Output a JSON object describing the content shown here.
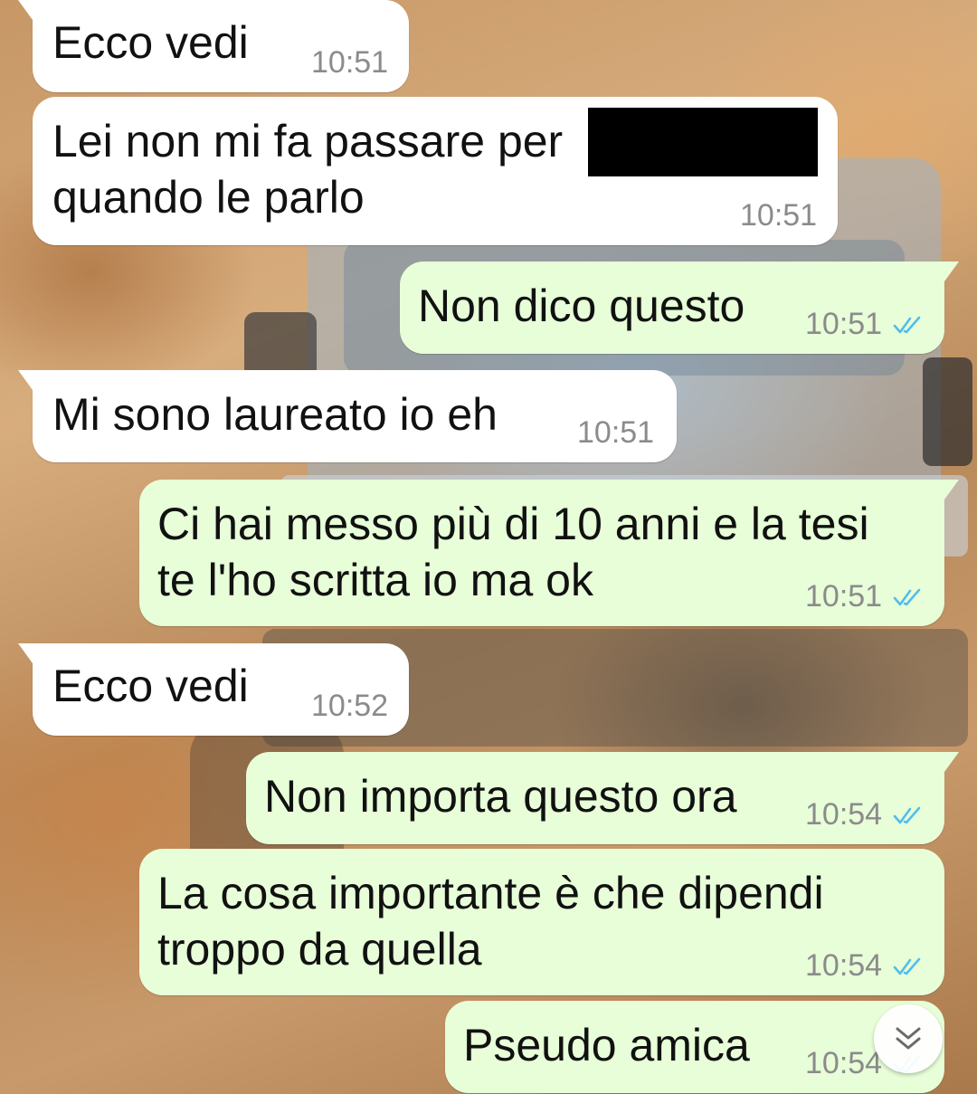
{
  "chat": {
    "messages": [
      {
        "text_lines": [
          "Ecco vedi"
        ],
        "time": "10:51",
        "direction": "incoming"
      },
      {
        "text_lines": [
          "Lei non mi fa passare per",
          "quando le parlo"
        ],
        "time": "10:51",
        "direction": "incoming",
        "redacted": true
      },
      {
        "text_lines": [
          "Non dico questo"
        ],
        "time": "10:51",
        "direction": "outgoing",
        "status": "read"
      },
      {
        "text_lines": [
          "Mi sono laureato io eh"
        ],
        "time": "10:51",
        "direction": "incoming"
      },
      {
        "text_lines": [
          "Ci hai messo più di 10 anni e la tesi",
          "te l'ho scritta io ma ok"
        ],
        "time": "10:51",
        "direction": "outgoing",
        "status": "read"
      },
      {
        "text_lines": [
          "Ecco vedi"
        ],
        "time": "10:52",
        "direction": "incoming"
      },
      {
        "text_lines": [
          "Non importa questo ora"
        ],
        "time": "10:54",
        "direction": "outgoing",
        "status": "read"
      },
      {
        "text_lines": [
          "La cosa importante è che dipendi",
          "troppo da quella"
        ],
        "time": "10:54",
        "direction": "outgoing",
        "status": "read"
      },
      {
        "text_lines": [
          "Pseudo amica"
        ],
        "time": "10:54",
        "direction": "outgoing",
        "status": "read"
      }
    ]
  },
  "icons": {
    "read_receipt": "double-check-icon",
    "scroll_down": "double-chevron-down-icon"
  },
  "colors": {
    "incoming_bubble": "#ffffff",
    "outgoing_bubble": "#e7fed8",
    "read_tick": "#53bdeb",
    "timestamp": "#8b8b8b"
  }
}
